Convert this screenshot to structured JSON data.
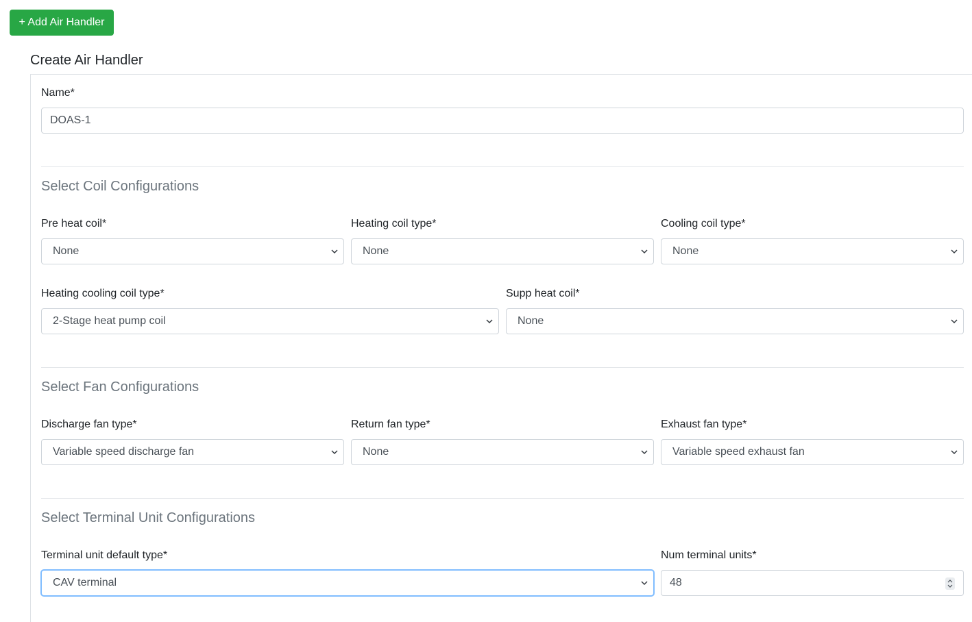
{
  "add_button": {
    "label": "+ Add Air Handler"
  },
  "form": {
    "title": "Create Air Handler",
    "name": {
      "label": "Name*",
      "value": "DOAS-1"
    },
    "coil_section": {
      "title": "Select Coil Configurations",
      "pre_heat_coil": {
        "label": "Pre heat coil*",
        "value": "None"
      },
      "heating_coil_type": {
        "label": "Heating coil type*",
        "value": "None"
      },
      "cooling_coil_type": {
        "label": "Cooling coil type*",
        "value": "None"
      },
      "heating_cooling_coil_type": {
        "label": "Heating cooling coil type*",
        "value": "2-Stage heat pump coil"
      },
      "supp_heat_coil": {
        "label": "Supp heat coil*",
        "value": "None"
      }
    },
    "fan_section": {
      "title": "Select Fan Configurations",
      "discharge_fan_type": {
        "label": "Discharge fan type*",
        "value": "Variable speed discharge fan"
      },
      "return_fan_type": {
        "label": "Return fan type*",
        "value": "None"
      },
      "exhaust_fan_type": {
        "label": "Exhaust fan type*",
        "value": "Variable speed exhaust fan"
      }
    },
    "terminal_section": {
      "title": "Select Terminal Unit Configurations",
      "terminal_unit_default_type": {
        "label": "Terminal unit default type*",
        "value": "CAV terminal"
      },
      "num_terminal_units": {
        "label": "Num terminal units*",
        "value": "48"
      }
    }
  },
  "colors": {
    "primary_button": "#28a745",
    "section_title": "#6c757d",
    "focus_border": "#80bdff"
  },
  "icons": {
    "select": "chevron-down-icon",
    "number": "spinner-icon"
  }
}
